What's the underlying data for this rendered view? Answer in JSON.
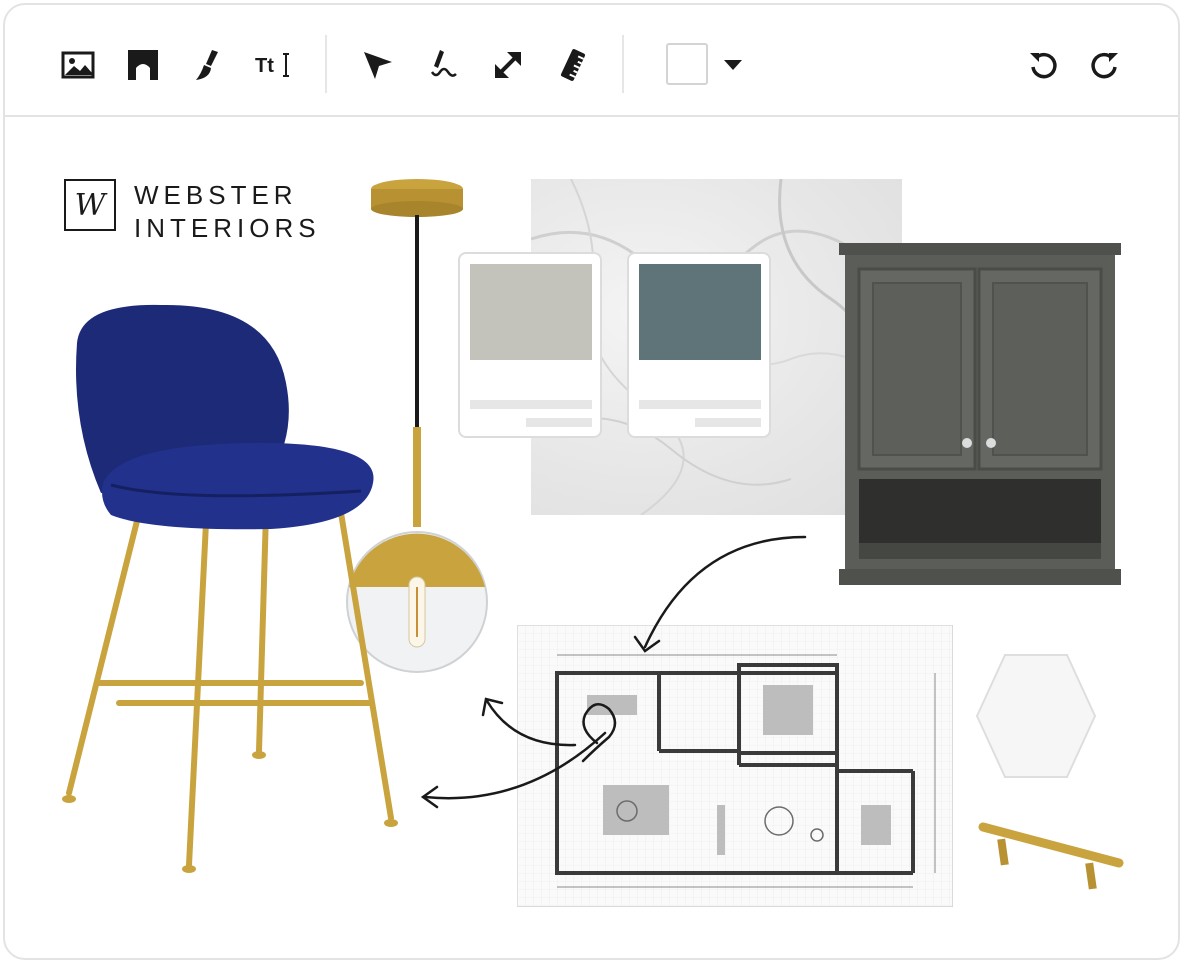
{
  "toolbar": {
    "tools": [
      {
        "name": "image-icon",
        "label": "Image"
      },
      {
        "name": "shape-icon",
        "label": "Shape"
      },
      {
        "name": "brush-icon",
        "label": "Brush"
      },
      {
        "name": "text-icon",
        "label": "Tt"
      },
      {
        "name": "select-arrow-icon",
        "label": "Select"
      },
      {
        "name": "pen-icon",
        "label": "Draw"
      },
      {
        "name": "resize-icon",
        "label": "Resize"
      },
      {
        "name": "ruler-icon",
        "label": "Measure"
      },
      {
        "name": "undo-icon",
        "label": "Undo"
      },
      {
        "name": "redo-icon",
        "label": "Redo"
      }
    ],
    "fill_color": "#ffffff"
  },
  "brand": {
    "monogram": "W",
    "line1": "WEBSTER",
    "line2": "INTERIORS"
  },
  "palette": [
    {
      "color": "#c3c3bc"
    },
    {
      "color": "#5f7478"
    }
  ],
  "colors": {
    "chair_velvet": "#1d2a78",
    "brass": "#c9a43e",
    "cabinet": "#5b5d59",
    "stroke": "#1a1a1a"
  }
}
